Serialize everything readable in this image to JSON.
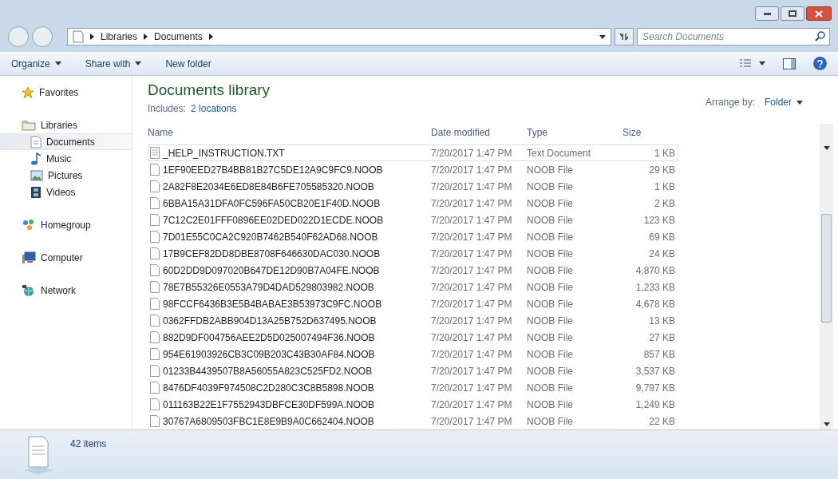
{
  "address": {
    "crumbs": [
      "Libraries",
      "Documents"
    ]
  },
  "search": {
    "placeholder": "Search Documents"
  },
  "toolbar": {
    "buttons": [
      {
        "label": "Organize",
        "menu": true
      },
      {
        "label": "Share with",
        "menu": true
      },
      {
        "label": "New folder",
        "menu": false
      }
    ]
  },
  "sidebar": {
    "groups": [
      {
        "label": "Favorites"
      },
      {
        "label": "Libraries",
        "children": [
          {
            "label": "Documents",
            "selected": true
          },
          {
            "label": "Music",
            "selected": false
          },
          {
            "label": "Pictures",
            "selected": false
          },
          {
            "label": "Videos",
            "selected": false
          }
        ]
      },
      {
        "label": "Homegroup"
      },
      {
        "label": "Computer"
      },
      {
        "label": "Network"
      }
    ]
  },
  "library": {
    "title": "Documents library",
    "includes_label": "Includes:",
    "includes_link": "2 locations",
    "arrange_label": "Arrange by:",
    "arrange_value": "Folder"
  },
  "table": {
    "columns": [
      "Name",
      "Date modified",
      "Type",
      "Size"
    ],
    "rows": [
      {
        "name": "_HELP_INSTRUCTION.TXT",
        "date": "7/20/2017 1:47 PM",
        "type": "Text Document",
        "size": "1 KB",
        "kind": "text",
        "focused": true
      },
      {
        "name": "1EF90EED27B4BB81B27C5DE12A9C9FC9.NOOB",
        "date": "7/20/2017 1:47 PM",
        "type": "NOOB File",
        "size": "29 KB",
        "kind": "file",
        "focused": false
      },
      {
        "name": "2A82F8E2034E6ED8E84B6FE705585320.NOOB",
        "date": "7/20/2017 1:47 PM",
        "type": "NOOB File",
        "size": "1 KB",
        "kind": "file",
        "focused": false
      },
      {
        "name": "6BBA15A31DFA0FC596FA50CB20E1F40D.NOOB",
        "date": "7/20/2017 1:47 PM",
        "type": "NOOB File",
        "size": "2 KB",
        "kind": "file",
        "focused": false
      },
      {
        "name": "7C12C2E01FFF0896EE02DED022D1ECDE.NOOB",
        "date": "7/20/2017 1:47 PM",
        "type": "NOOB File",
        "size": "123 KB",
        "kind": "file",
        "focused": false
      },
      {
        "name": "7D01E55C0CA2C920B7462B540F62AD68.NOOB",
        "date": "7/20/2017 1:47 PM",
        "type": "NOOB File",
        "size": "69 KB",
        "kind": "file",
        "focused": false
      },
      {
        "name": "17B9CEF82DD8DBE8708F646630DAC030.NOOB",
        "date": "7/20/2017 1:47 PM",
        "type": "NOOB File",
        "size": "24 KB",
        "kind": "file",
        "focused": false
      },
      {
        "name": "60D2DD9D097020B647DE12D90B7A04FE.NOOB",
        "date": "7/20/2017 1:47 PM",
        "type": "NOOB File",
        "size": "4,870 KB",
        "kind": "file",
        "focused": false
      },
      {
        "name": "78E7B55326E0553A79D4DAD529803982.NOOB",
        "date": "7/20/2017 1:47 PM",
        "type": "NOOB File",
        "size": "1,233 KB",
        "kind": "file",
        "focused": false
      },
      {
        "name": "98FCCF6436B3E5B4BABAE3B53973C9FC.NOOB",
        "date": "7/20/2017 1:47 PM",
        "type": "NOOB File",
        "size": "4,678 KB",
        "kind": "file",
        "focused": false
      },
      {
        "name": "0362FFDB2ABB904D13A25B752D637495.NOOB",
        "date": "7/20/2017 1:47 PM",
        "type": "NOOB File",
        "size": "13 KB",
        "kind": "file",
        "focused": false
      },
      {
        "name": "882D9DF004756AEE2D5D025007494F36.NOOB",
        "date": "7/20/2017 1:47 PM",
        "type": "NOOB File",
        "size": "27 KB",
        "kind": "file",
        "focused": false
      },
      {
        "name": "954E61903926CB3C09B203C43B30AF84.NOOB",
        "date": "7/20/2017 1:47 PM",
        "type": "NOOB File",
        "size": "857 KB",
        "kind": "file",
        "focused": false
      },
      {
        "name": "01233B4439507B8A56055A823C525FD2.NOOB",
        "date": "7/20/2017 1:47 PM",
        "type": "NOOB File",
        "size": "3,537 KB",
        "kind": "file",
        "focused": false
      },
      {
        "name": "8476DF4039F974508C2D280C3C8B5898.NOOB",
        "date": "7/20/2017 1:47 PM",
        "type": "NOOB File",
        "size": "9,797 KB",
        "kind": "file",
        "focused": false
      },
      {
        "name": "011163B22E1F7552943DBFCE30DF599A.NOOB",
        "date": "7/20/2017 1:47 PM",
        "type": "NOOB File",
        "size": "1,249 KB",
        "kind": "file",
        "focused": false
      },
      {
        "name": "30767A6809503FBC1E8E9B9A0C662404.NOOB",
        "date": "7/20/2017 1:47 PM",
        "type": "NOOB File",
        "size": "22 KB",
        "kind": "file",
        "focused": false
      }
    ]
  },
  "status_bar": {
    "count": "42 items"
  }
}
